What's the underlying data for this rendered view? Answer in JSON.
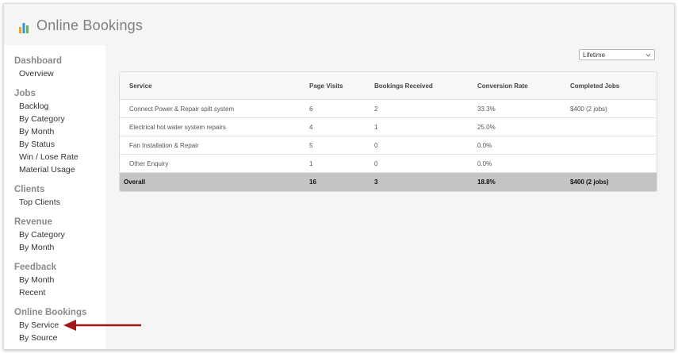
{
  "app": {
    "title": "Online Bookings",
    "icon": "bar-chart-icon"
  },
  "sidebar": {
    "sections": [
      {
        "title": "Dashboard",
        "items": [
          "Overview"
        ]
      },
      {
        "title": "Jobs",
        "items": [
          "Backlog",
          "By Category",
          "By Month",
          "By Status",
          "Win / Lose Rate",
          "Material Usage"
        ]
      },
      {
        "title": "Clients",
        "items": [
          "Top Clients"
        ]
      },
      {
        "title": "Revenue",
        "items": [
          "By Category",
          "By Month"
        ]
      },
      {
        "title": "Feedback",
        "items": [
          "By Month",
          "Recent"
        ]
      },
      {
        "title": "Online Bookings",
        "items": [
          "By Service",
          "By Source"
        ]
      }
    ]
  },
  "filter": {
    "selected": "Lifetime"
  },
  "table": {
    "columns": [
      "Service",
      "Page Visits",
      "Bookings Received",
      "Conversion Rate",
      "Completed Jobs"
    ],
    "rows": [
      [
        "Connect Power & Repair spilt system",
        "6",
        "2",
        "33.3%",
        "$400 (2 jobs)"
      ],
      [
        "Electrical hot water system repairs",
        "4",
        "1",
        "25.0%",
        ""
      ],
      [
        "Fan Installation & Repair",
        "5",
        "0",
        "0.0%",
        ""
      ],
      [
        "Other Enquiry",
        "1",
        "0",
        "0.0%",
        ""
      ]
    ],
    "overall": [
      "Overall",
      "16",
      "3",
      "18.8%",
      "$400 (2 jobs)"
    ]
  },
  "colors": {
    "logo_bars": [
      "#f0a020",
      "#3a8fd6",
      "#5cb85c"
    ],
    "arrow": "#a01818",
    "overall_row": "#c4c4c4"
  }
}
